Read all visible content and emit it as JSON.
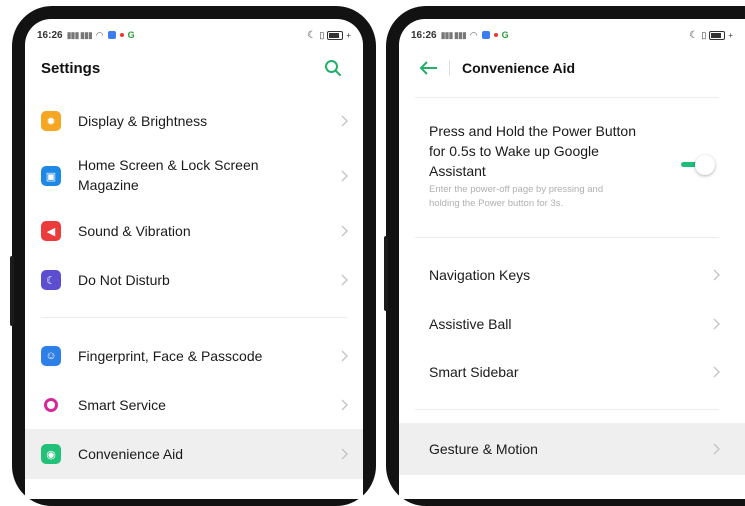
{
  "left": {
    "status": {
      "time": "16:26"
    },
    "header": {
      "title": "Settings"
    },
    "items": [
      {
        "label": "Display & Brightness",
        "color": "#f5a623",
        "icon": "sun-icon"
      },
      {
        "label": "Home Screen & Lock Screen",
        "label2": "Magazine",
        "color": "#1e88e5",
        "icon": "home-screen-icon"
      },
      {
        "label": "Sound & Vibration",
        "color": "#ec3b3b",
        "icon": "speaker-icon"
      },
      {
        "label": "Do Not Disturb",
        "color": "#5c4ecf",
        "icon": "moon-icon"
      },
      {
        "label": "Fingerprint, Face & Passcode",
        "color": "#2f7fe8",
        "icon": "face-id-icon"
      },
      {
        "label": "Smart Service",
        "color": "#d6289a",
        "icon": "smart-service-icon"
      },
      {
        "label": "Convenience Aid",
        "color": "#23c07a",
        "icon": "convenience-aid-icon"
      }
    ]
  },
  "right": {
    "status": {
      "time": "16:26"
    },
    "header": {
      "title": "Convenience Aid"
    },
    "power": {
      "line1": "Press and Hold the Power Button",
      "line2": "for 0.5s to Wake up Google",
      "line3": "Assistant",
      "desc1": "Enter the power-off page by pressing and",
      "desc2": "holding the Power button for 3s.",
      "toggle_on": true
    },
    "items": [
      {
        "label": "Navigation Keys"
      },
      {
        "label": "Assistive Ball"
      },
      {
        "label": "Smart Sidebar"
      },
      {
        "label": "Gesture & Motion"
      }
    ]
  }
}
